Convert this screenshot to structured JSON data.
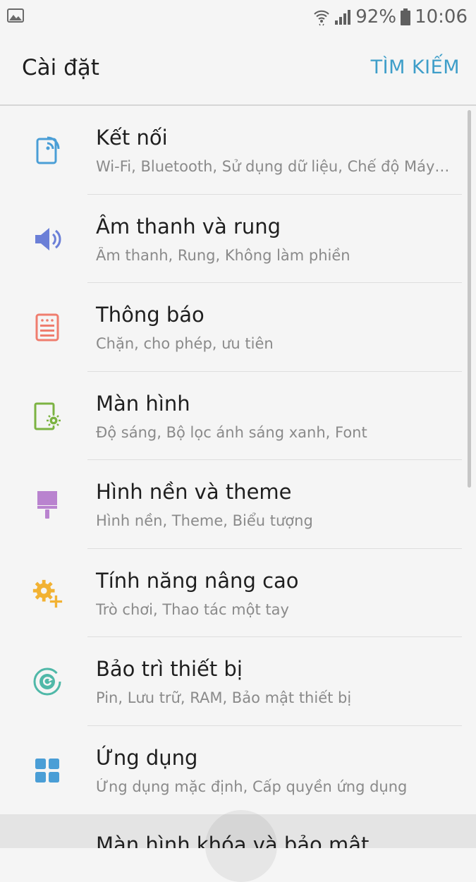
{
  "status_bar": {
    "battery": "92%",
    "time": "10:06",
    "icons": [
      "gallery-notification-icon",
      "wifi-icon",
      "cell-signal-icon",
      "battery-icon"
    ]
  },
  "header": {
    "title": "Cài đặt",
    "search_label": "TÌM KIẾM"
  },
  "settings": [
    {
      "label": "Kết nối",
      "sub": "Wi-Fi, Bluetooth, Sử dụng dữ liệu, Chế độ Máy bay",
      "icon": "connections-icon",
      "color": "#4a9ed6"
    },
    {
      "label": "Âm thanh và rung",
      "sub": "Âm thanh, Rung, Không làm phiền",
      "icon": "speaker-icon",
      "color": "#6b7fd7"
    },
    {
      "label": "Thông báo",
      "sub": "Chặn, cho phép, ưu tiên",
      "icon": "notifications-icon",
      "color": "#ef7d6e"
    },
    {
      "label": "Màn hình",
      "sub": "Độ sáng, Bộ lọc ánh sáng xanh, Font",
      "icon": "display-icon",
      "color": "#7cb342"
    },
    {
      "label": "Hình nền và theme",
      "sub": "Hình nền, Theme, Biểu tượng",
      "icon": "wallpaper-brush-icon",
      "color": "#b983cf"
    },
    {
      "label": "Tính năng nâng cao",
      "sub": "Trò chơi, Thao tác một tay",
      "icon": "advanced-gear-plus-icon",
      "color": "#f2b233"
    },
    {
      "label": "Bảo trì thiết bị",
      "sub": "Pin, Lưu trữ, RAM, Bảo mật thiết bị",
      "icon": "device-maintenance-icon",
      "color": "#4fb8a8"
    },
    {
      "label": "Ứng dụng",
      "sub": "Ứng dụng mặc định, Cấp quyền ứng dụng",
      "icon": "apps-grid-icon",
      "color": "#4a9ed6"
    },
    {
      "label": "Màn hình khóa và bảo mật",
      "sub": "",
      "icon": "",
      "color": ""
    }
  ]
}
